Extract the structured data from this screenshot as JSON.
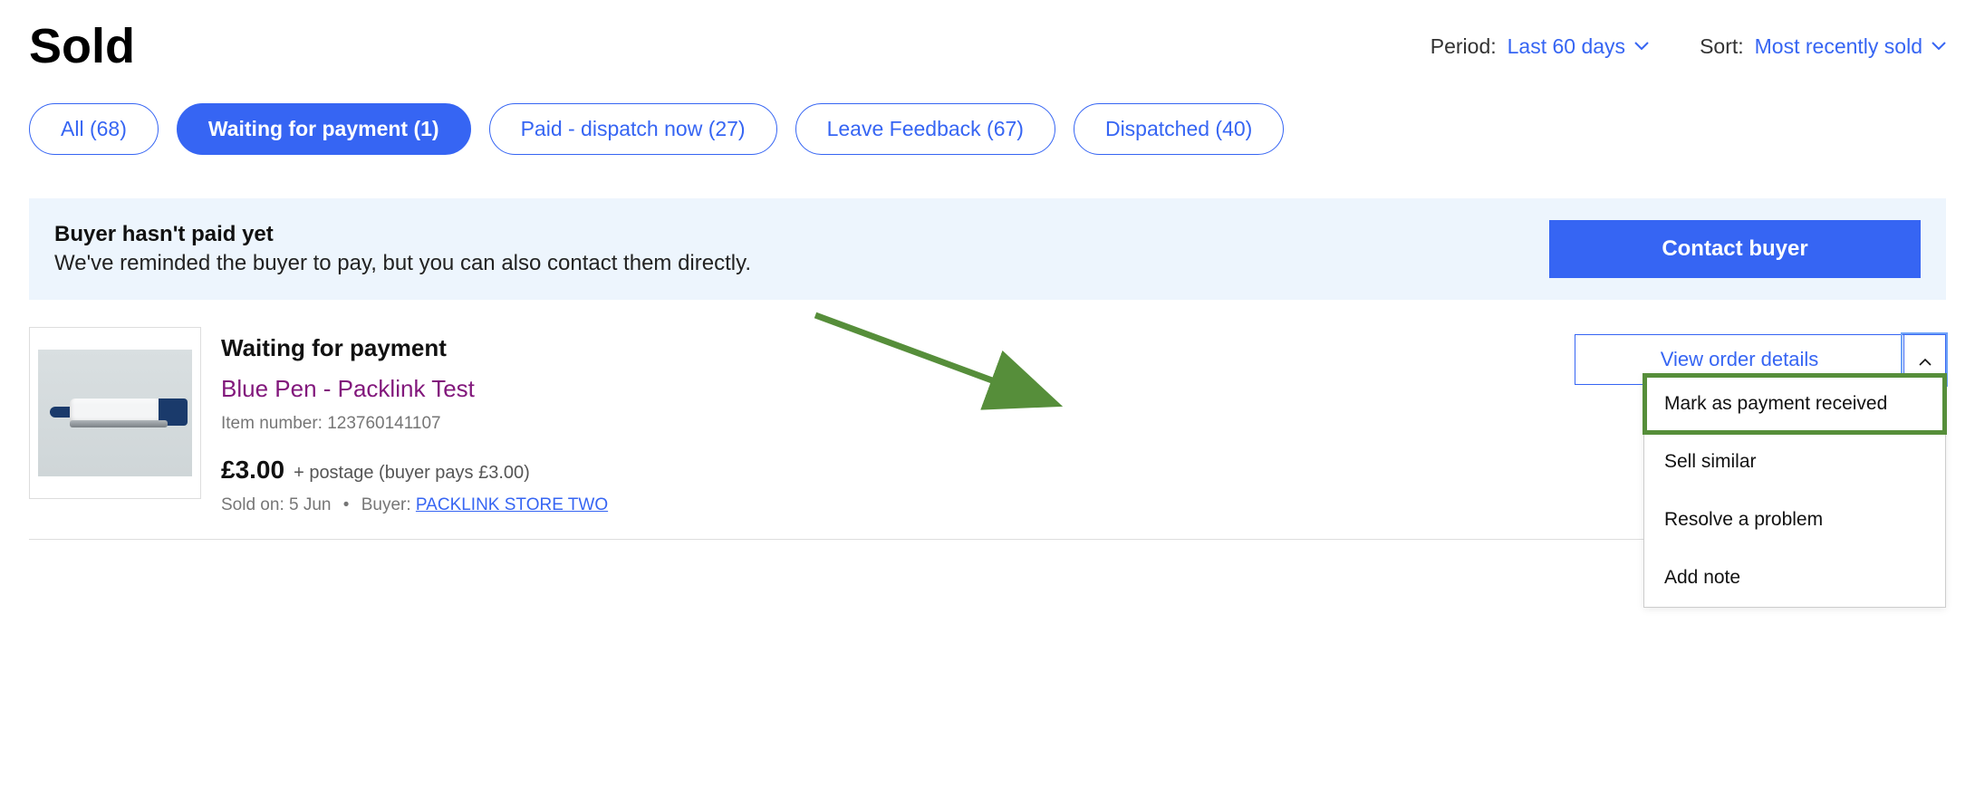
{
  "header": {
    "title": "Sold",
    "period_label": "Period:",
    "period_value": "Last 60 days",
    "sort_label": "Sort:",
    "sort_value": "Most recently sold"
  },
  "tabs": [
    {
      "label": "All (68)",
      "active": false
    },
    {
      "label": "Waiting for payment (1)",
      "active": true
    },
    {
      "label": "Paid - dispatch now (27)",
      "active": false
    },
    {
      "label": "Leave Feedback (67)",
      "active": false
    },
    {
      "label": "Dispatched (40)",
      "active": false
    }
  ],
  "alert": {
    "title": "Buyer hasn't paid yet",
    "subtitle": "We've reminded the buyer to pay, but you can also contact them directly.",
    "button_label": "Contact buyer"
  },
  "order": {
    "status": "Waiting for payment",
    "item_title": "Blue Pen - Packlink Test",
    "item_number_label": "Item number: ",
    "item_number": "123760141107",
    "price": "£3.00",
    "postage_text": "+ postage (buyer pays £3.00)",
    "sold_on_label": "Sold on: ",
    "sold_on_value": "5 Jun",
    "buyer_label": "Buyer: ",
    "buyer_name": "PACKLINK STORE TWO",
    "view_details_label": "View order details",
    "dropdown": [
      "Mark as payment received",
      "Sell similar",
      "Resolve a problem",
      "Add note"
    ]
  }
}
